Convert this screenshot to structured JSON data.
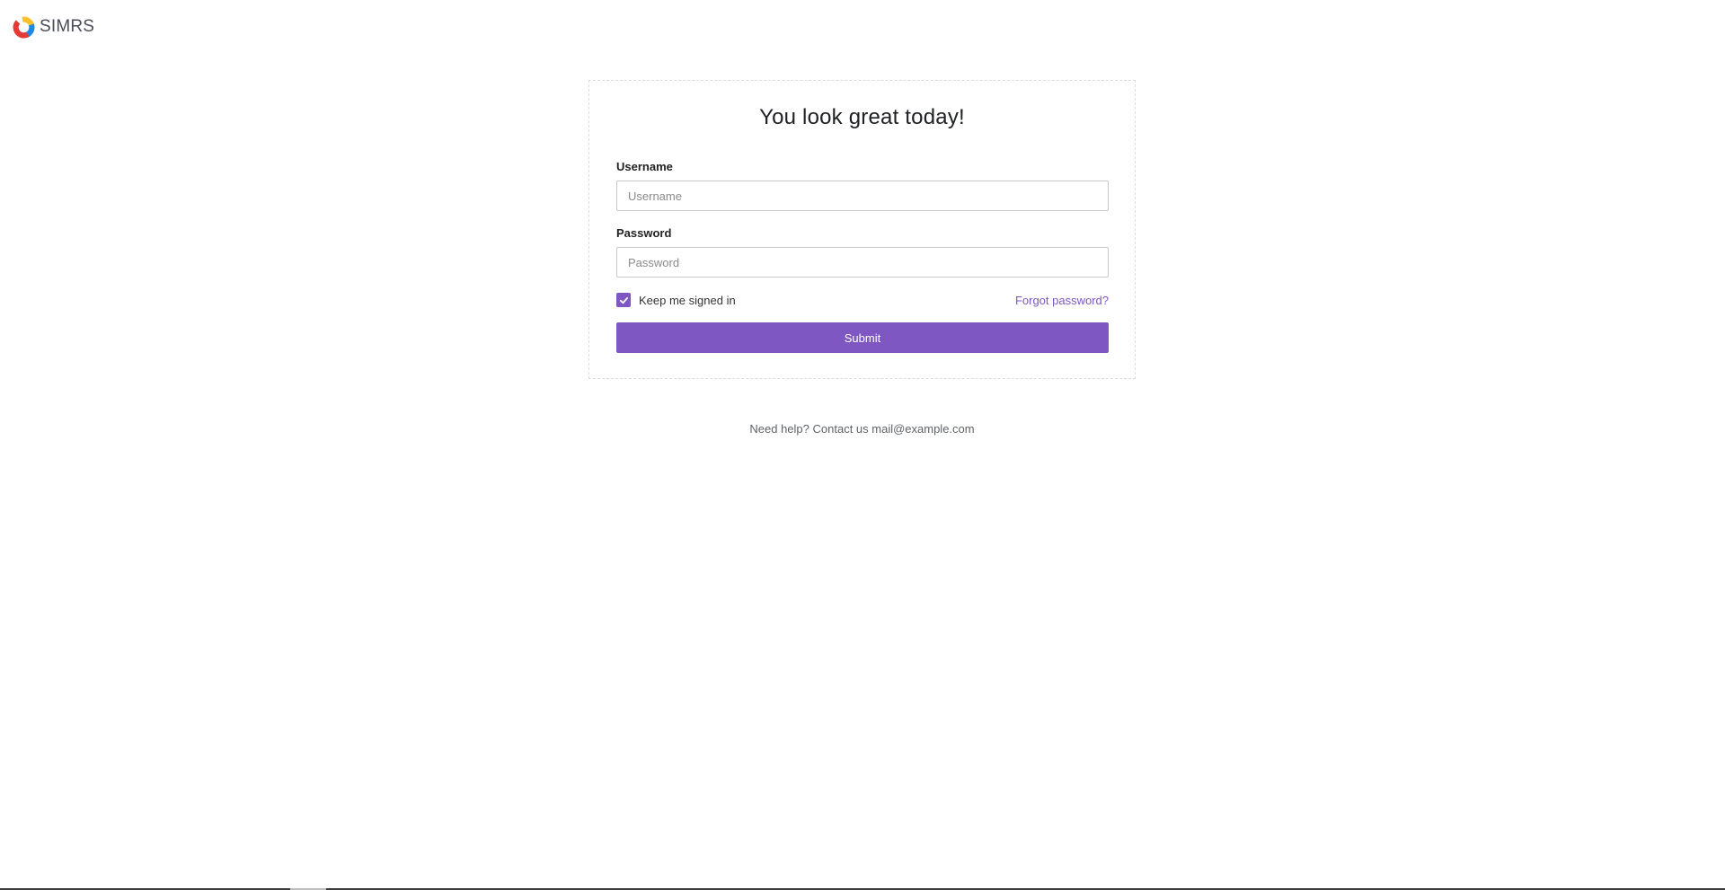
{
  "header": {
    "brand_name": "SIMRS",
    "logo_icon": "donut-logo-icon"
  },
  "login": {
    "title": "You look great today!",
    "username_label": "Username",
    "username_placeholder": "Username",
    "username_value": "",
    "password_label": "Password",
    "password_placeholder": "Password",
    "password_value": "",
    "remember_label": "Keep me signed in",
    "remember_checked": true,
    "forgot_label": "Forgot password?",
    "submit_label": "Submit"
  },
  "footer": {
    "help_text": "Need help? Contact us mail@example.com"
  },
  "colors": {
    "accent": "#7e57c2",
    "logo_red": "#e53935",
    "logo_yellow": "#fbc02d",
    "logo_blue": "#1e88e5"
  }
}
